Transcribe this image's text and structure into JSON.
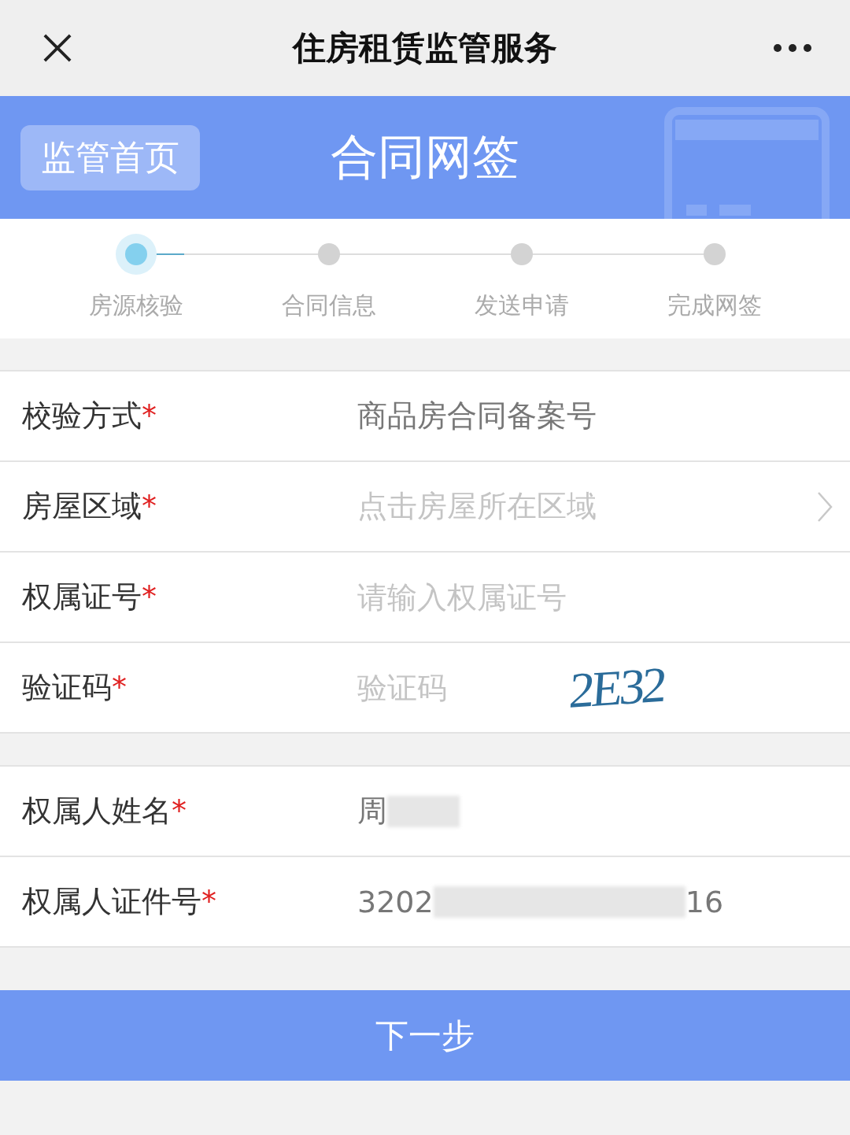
{
  "nav": {
    "title": "住房租赁监管服务"
  },
  "header": {
    "home_button": "监管首页",
    "title": "合同网签"
  },
  "steps": [
    {
      "label": "房源核验",
      "selected": true
    },
    {
      "label": "合同信息",
      "selected": false
    },
    {
      "label": "发送申请",
      "selected": false
    },
    {
      "label": "完成网签",
      "selected": false
    }
  ],
  "groups": [
    [
      {
        "kind": "value",
        "label": "校验方式",
        "required_mark": "*",
        "value": "商品房合同备案号"
      },
      {
        "kind": "select",
        "label": "房屋区域",
        "required_mark": "*",
        "placeholder": "点击房屋所在区域"
      },
      {
        "kind": "input",
        "label": "权属证号",
        "required_mark": "*",
        "placeholder": "请输入权属证号"
      },
      {
        "kind": "captcha",
        "label": "验证码",
        "required_mark": "*",
        "placeholder": "验证码",
        "captcha": "2E32"
      }
    ],
    [
      {
        "kind": "masked",
        "label": "权属人姓名",
        "required_mark": "*",
        "prefix": "周"
      },
      {
        "kind": "masked",
        "label": "权属人证件号",
        "required_mark": "*",
        "prefix": "3202",
        "suffix": "16"
      }
    ]
  ],
  "next_button": "下一步"
}
